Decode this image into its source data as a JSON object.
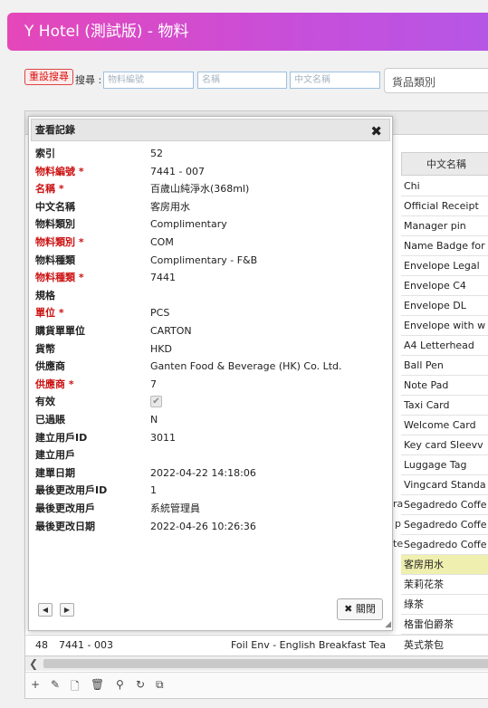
{
  "header": {
    "title": "Y Hotel (測試版) - 物料"
  },
  "search": {
    "reset_label": "重設搜尋",
    "label": "搜尋 :",
    "fields": [
      {
        "placeholder": "物料編號"
      },
      {
        "placeholder": "名稱"
      },
      {
        "placeholder": "中文名稱"
      }
    ],
    "category_select": "貨品類別"
  },
  "grid": {
    "col_header": "中文名稱",
    "rows": [
      {
        "col": "Chi",
        "highlight": false
      },
      {
        "col": "Official Receipt",
        "highlight": false
      },
      {
        "col": "Manager pin",
        "highlight": false
      },
      {
        "col": "Name Badge for",
        "highlight": false
      },
      {
        "col": "Envelope Legal",
        "highlight": false
      },
      {
        "col": "Envelope C4",
        "highlight": false
      },
      {
        "col": "Envelope DL",
        "highlight": false
      },
      {
        "col": "Envelope with w",
        "highlight": false
      },
      {
        "col": "A4 Letterhead",
        "highlight": false
      },
      {
        "col": "Ball Pen",
        "highlight": false
      },
      {
        "col": "Note Pad",
        "highlight": false
      },
      {
        "col": "Taxi Card",
        "highlight": false
      },
      {
        "col": "Welcome Card",
        "highlight": false
      },
      {
        "col": "Key card Sleevv",
        "highlight": false
      },
      {
        "col": "Luggage Tag",
        "highlight": false
      },
      {
        "col": "Vingcard Standa",
        "highlight": false
      },
      {
        "col": "Segadredo Coffe",
        "highlight": false
      },
      {
        "col": "Segadredo Coffe",
        "highlight": false
      },
      {
        "col": "Segadredo Coffe",
        "highlight": false
      },
      {
        "col": "客房用水",
        "highlight": true
      },
      {
        "col": "茉莉花茶",
        "highlight": false
      },
      {
        "col": "綠茶",
        "highlight": false
      },
      {
        "col": "格雷伯爵茶",
        "highlight": false
      }
    ],
    "leak_chars": [
      "ra",
      "p",
      "te"
    ],
    "last_row": {
      "index": "48",
      "code": "7441 - 003",
      "name": "Foil Env - English Breakfast Tea",
      "chinese": "英式茶包"
    }
  },
  "dialog": {
    "title": "查看記錄",
    "close_label": "關閉",
    "fields": [
      {
        "label": "索引",
        "value": "52",
        "required": false
      },
      {
        "label": "物料編號 *",
        "value": "7441 - 007",
        "required": true
      },
      {
        "label": "名稱 *",
        "value": "百歲山純淨水(368ml)",
        "required": true
      },
      {
        "label": "中文名稱",
        "value": "客房用水",
        "required": false
      },
      {
        "label": "物料類別",
        "value": "Complimentary",
        "required": false
      },
      {
        "label": "物料類別 *",
        "value": "COM",
        "required": true
      },
      {
        "label": "物料種類",
        "value": "Complimentary - F&B",
        "required": false
      },
      {
        "label": "物料種類 *",
        "value": "7441",
        "required": true
      },
      {
        "label": "規格",
        "value": "",
        "required": false
      },
      {
        "label": "單位 *",
        "value": "PCS",
        "required": true
      },
      {
        "label": "購貨單單位",
        "value": "CARTON",
        "required": false
      },
      {
        "label": "貨幣",
        "value": "HKD",
        "required": false
      },
      {
        "label": "供應商",
        "value": "Ganten Food & Beverage (HK) Co. Ltd.",
        "required": false
      },
      {
        "label": "供應商 *",
        "value": "7",
        "required": true
      },
      {
        "label": "有效",
        "value": "",
        "required": false,
        "checkbox": true,
        "checked": true
      },
      {
        "label": "已過賬",
        "value": "N",
        "required": false
      },
      {
        "label": "建立用戶ID",
        "value": "3011",
        "required": false
      },
      {
        "label": "建立用戶",
        "value": "",
        "required": false
      },
      {
        "label": "建單日期",
        "value": "2022-04-22 14:18:06",
        "required": false
      },
      {
        "label": "最後更改用戶ID",
        "value": "1",
        "required": false
      },
      {
        "label": "最後更改用戶",
        "value": "系統管理員",
        "required": false
      },
      {
        "label": "最後更改日期",
        "value": "2022-04-26 10:26:36",
        "required": false
      }
    ]
  },
  "icons": {
    "dialog_close": "close-icon",
    "prev": "prev-arrow-icon",
    "next": "next-arrow-icon",
    "toolbar": [
      "add-icon",
      "edit-icon",
      "view-icon",
      "delete-icon",
      "search-icon",
      "refresh-icon",
      "columns-icon"
    ]
  },
  "colors": {
    "header_start": "#e547b9",
    "header_end": "#b556e6",
    "required": "#cc1111",
    "highlight_row": "#efefaf"
  }
}
